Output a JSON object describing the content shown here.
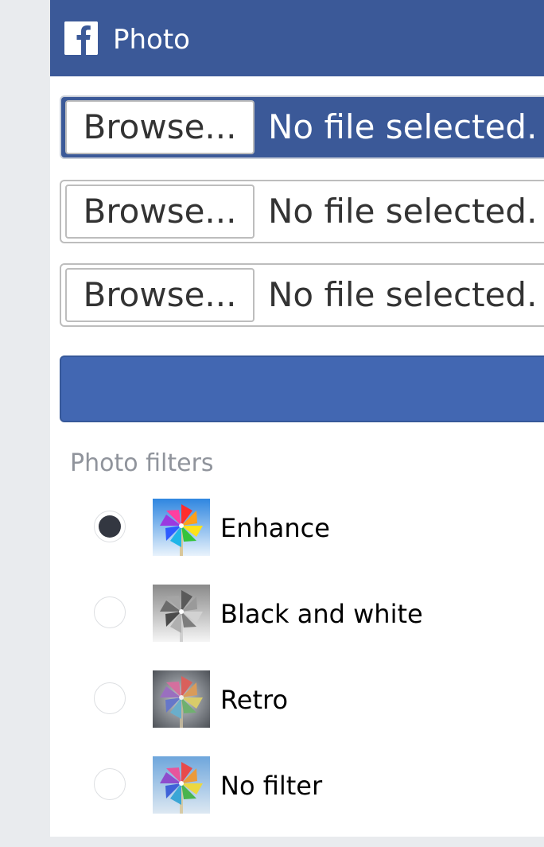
{
  "header": {
    "title": "Photo",
    "icon": "facebook-logo-icon",
    "background_color": "#3b5998"
  },
  "upload": {
    "rows": [
      {
        "button_label": "Browse...",
        "status": "No file selected.",
        "focused": true
      },
      {
        "button_label": "Browse...",
        "status": "No file selected.",
        "focused": false
      },
      {
        "button_label": "Browse...",
        "status": "No file selected.",
        "focused": false
      }
    ]
  },
  "submit_bar": {
    "color": "#4267b2"
  },
  "filters": {
    "heading": "Photo filters",
    "selected": "Enhance",
    "options": [
      {
        "label": "Enhance",
        "thumbnail": "pinwheel-enhance-icon",
        "checked": true
      },
      {
        "label": "Black and white",
        "thumbnail": "pinwheel-black-and-white-icon",
        "checked": false
      },
      {
        "label": "Retro",
        "thumbnail": "pinwheel-retro-icon",
        "checked": false
      },
      {
        "label": "No filter",
        "thumbnail": "pinwheel-no-filter-icon",
        "checked": false
      }
    ]
  }
}
